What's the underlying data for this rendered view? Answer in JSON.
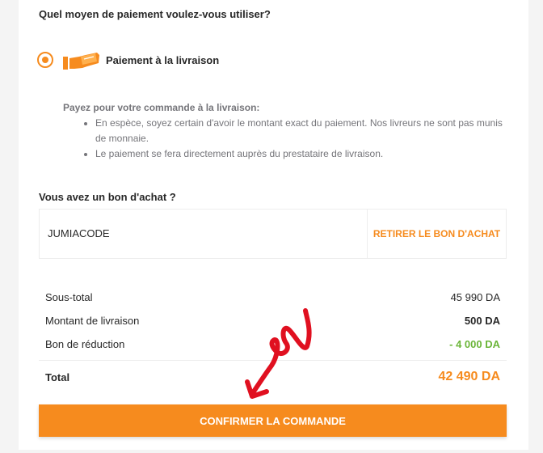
{
  "payment": {
    "question": "Quel moyen de paiement voulez-vous utiliser?",
    "option_label": "Paiement à la livraison",
    "option_icon": "cash-hand-icon",
    "selected": true,
    "info_title": "Payez pour votre commande à la livraison:",
    "info_items": [
      "En espèce, soyez certain d'avoir le montant exact du paiement. Nos livreurs ne sont pas munis de monnaie.",
      "Le paiement se fera directement auprès du prestataire de livraison."
    ]
  },
  "voucher": {
    "question": "Vous avez un bon d'achat ?",
    "code": "JUMIACODE",
    "remove_label": "RETIRER LE BON D'ACHAT"
  },
  "summary": {
    "rows": [
      {
        "label": "Sous-total",
        "value": "45 990  DA"
      },
      {
        "label": "Montant de livraison",
        "value": "500  DA"
      },
      {
        "label": "Bon de réduction",
        "value": "- 4 000  DA"
      }
    ],
    "total_label": "Total",
    "total_value": "42 490  DA"
  },
  "actions": {
    "confirm_label": "CONFIRMER LA COMMANDE"
  },
  "colors": {
    "accent": "#f68b1e",
    "discount": "#6bb539",
    "annotation": "#e01020"
  }
}
